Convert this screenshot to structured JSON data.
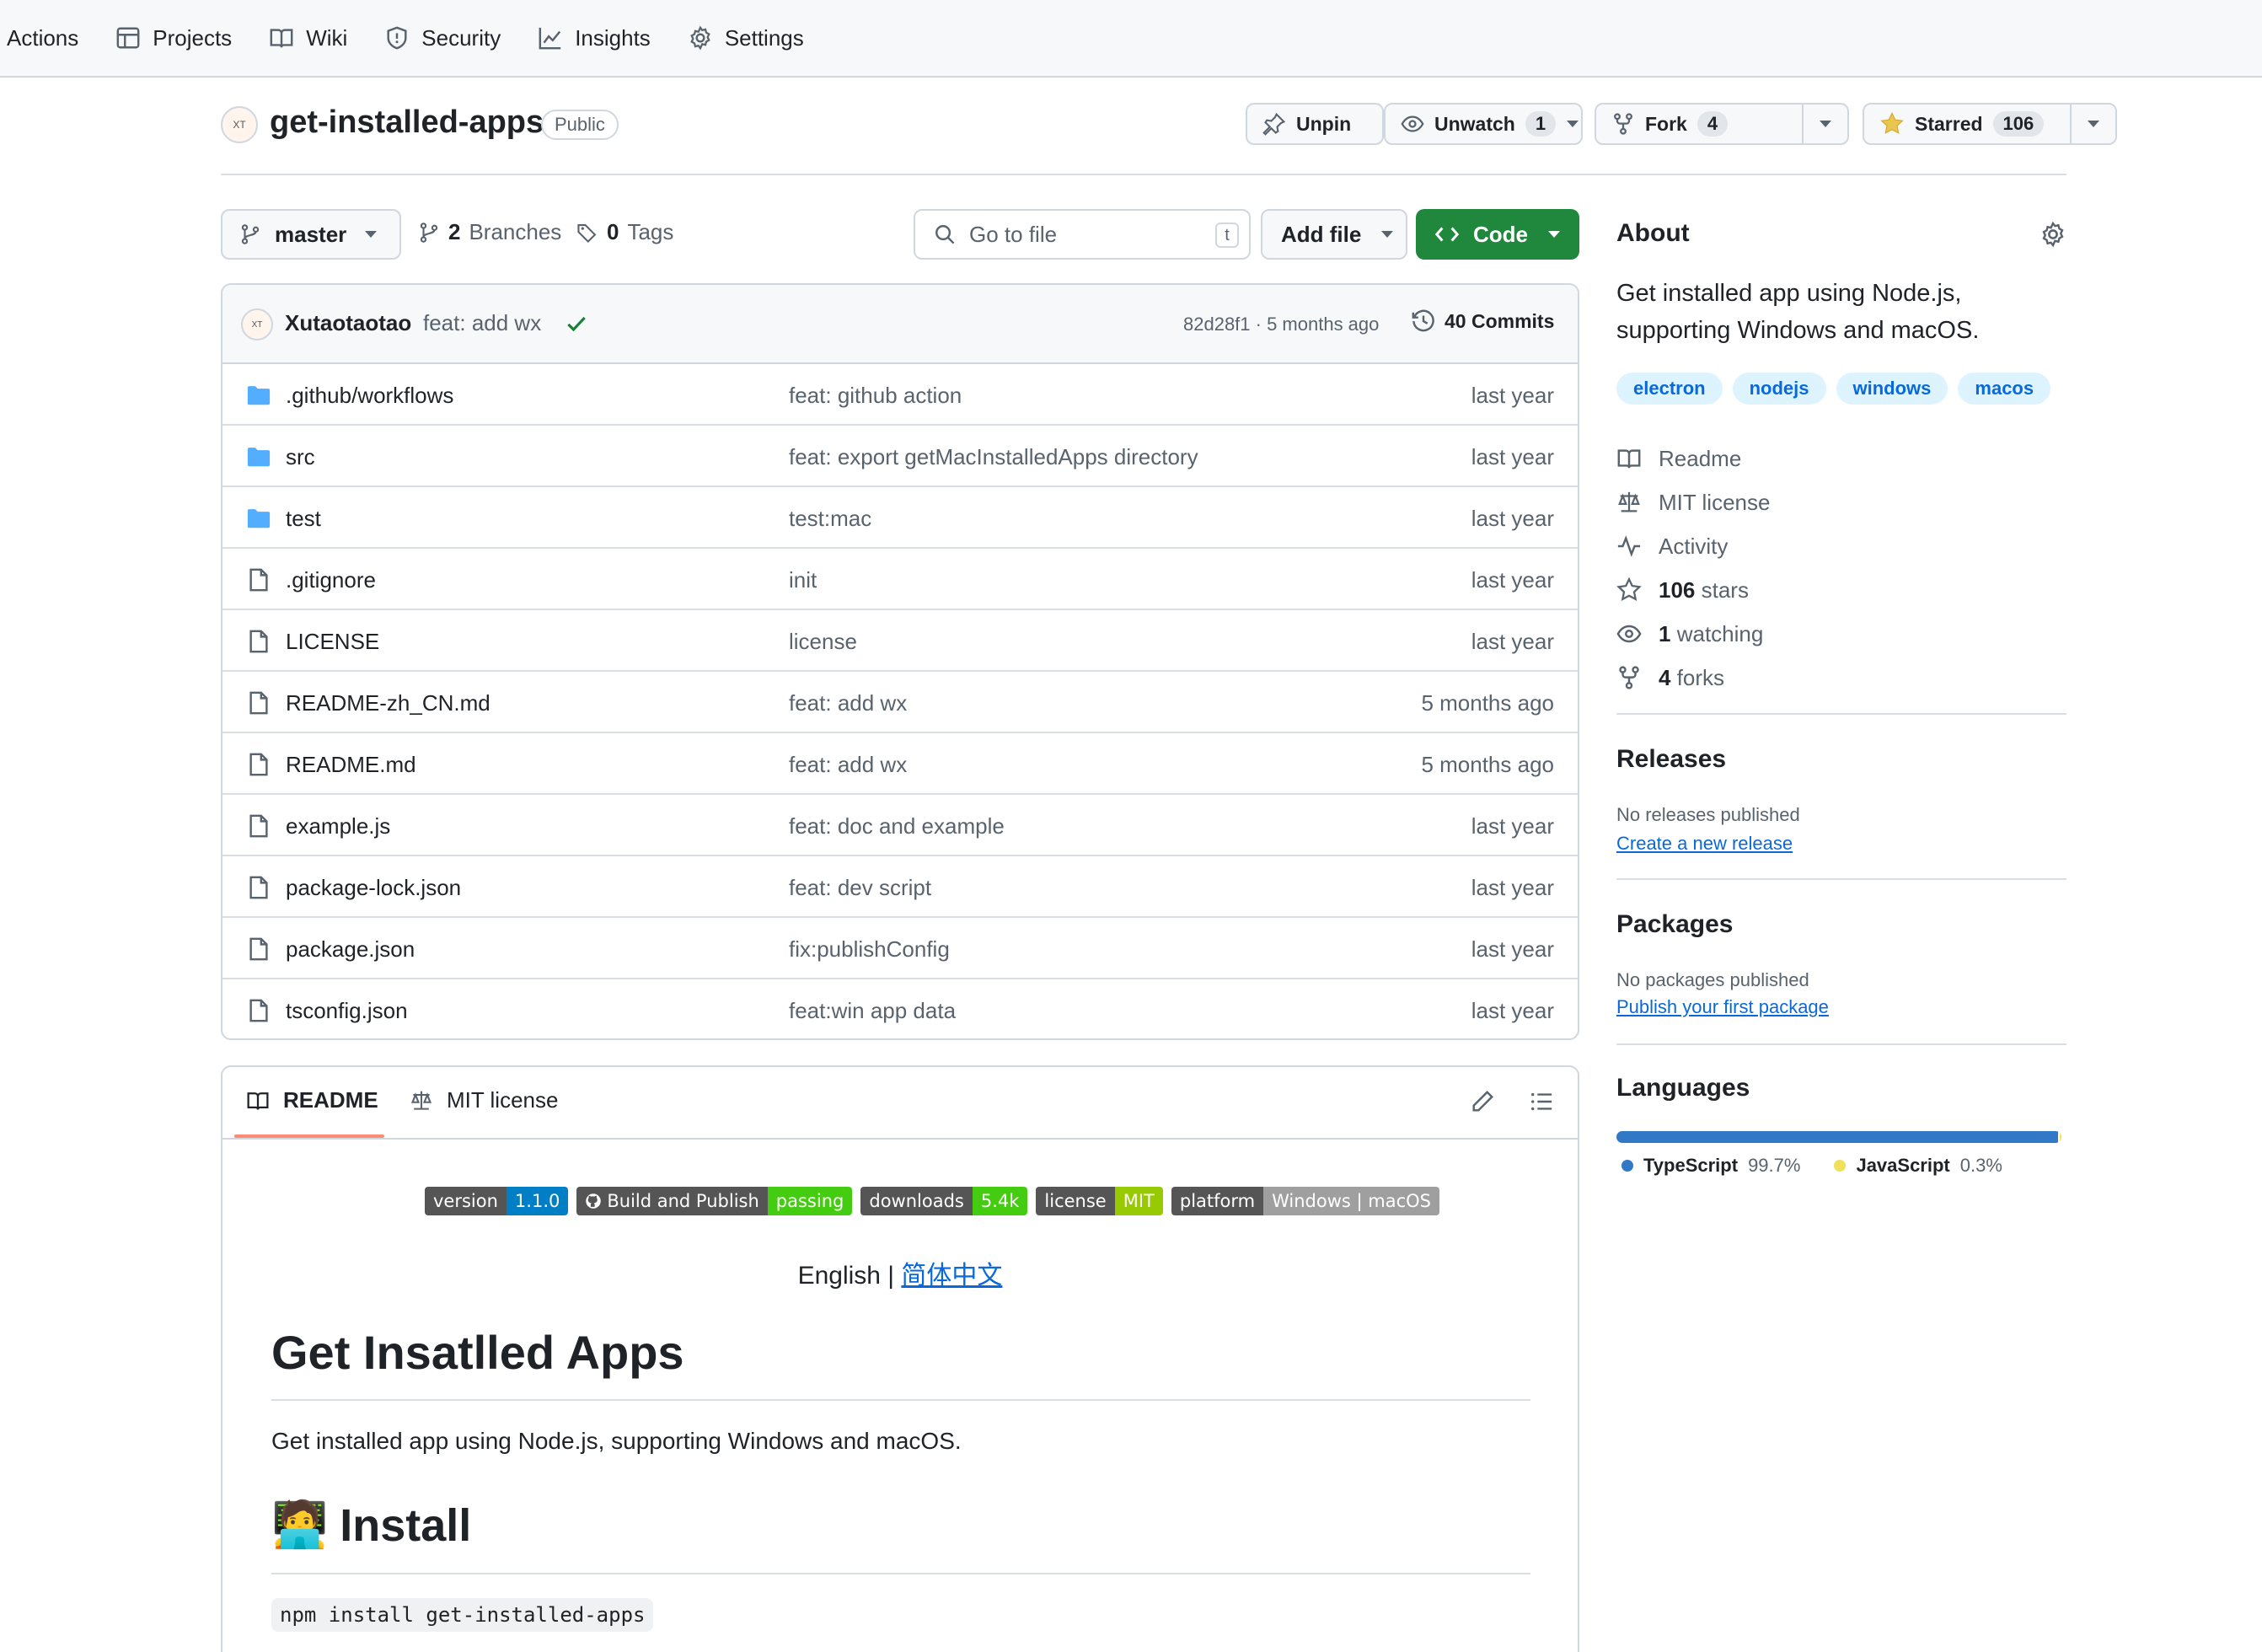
{
  "nav": {
    "items": [
      {
        "label": "Actions"
      },
      {
        "label": "Projects"
      },
      {
        "label": "Wiki"
      },
      {
        "label": "Security"
      },
      {
        "label": "Insights"
      },
      {
        "label": "Settings"
      }
    ]
  },
  "repo": {
    "avatar_text": "XT",
    "name": "get-installed-apps",
    "visibility": "Public",
    "unpin_label": "Unpin",
    "unwatch_label": "Unwatch",
    "watch_count": "1",
    "fork_label": "Fork",
    "fork_count": "4",
    "star_label": "Starred",
    "star_count": "106"
  },
  "toolbar": {
    "branch": "master",
    "branches_count": "2",
    "branches_label": "Branches",
    "tags_count": "0",
    "tags_label": "Tags",
    "goto_placeholder": "Go to file",
    "goto_shortcut": "t",
    "add_file_label": "Add file",
    "code_label": "Code"
  },
  "commit": {
    "author": "Xutaotaotao",
    "message": "feat: add wx",
    "sha_time": "82d28f1 · 5 months ago",
    "commits_label": "40 Commits"
  },
  "files": [
    {
      "type": "folder",
      "name": ".github/workflows",
      "commit": "feat: github action",
      "time": "last year"
    },
    {
      "type": "folder",
      "name": "src",
      "commit": "feat: export getMacInstalledApps directory",
      "time": "last year"
    },
    {
      "type": "folder",
      "name": "test",
      "commit": "test:mac",
      "time": "last year"
    },
    {
      "type": "file",
      "name": ".gitignore",
      "commit": "init",
      "time": "last year"
    },
    {
      "type": "file",
      "name": "LICENSE",
      "commit": "license",
      "time": "last year"
    },
    {
      "type": "file",
      "name": "README-zh_CN.md",
      "commit": "feat: add wx",
      "time": "5 months ago"
    },
    {
      "type": "file",
      "name": "README.md",
      "commit": "feat: add wx",
      "time": "5 months ago"
    },
    {
      "type": "file",
      "name": "example.js",
      "commit": "feat: doc and example",
      "time": "last year"
    },
    {
      "type": "file",
      "name": "package-lock.json",
      "commit": "feat: dev script",
      "time": "last year"
    },
    {
      "type": "file",
      "name": "package.json",
      "commit": "fix:publishConfig",
      "time": "last year"
    },
    {
      "type": "file",
      "name": "tsconfig.json",
      "commit": "feat:win app data",
      "time": "last year"
    }
  ],
  "readme": {
    "tab_readme": "README",
    "tab_license": "MIT license",
    "badges": [
      {
        "left": "version",
        "right": "1.1.0",
        "color": "#007ec6"
      },
      {
        "left": "Build and Publish",
        "right": "passing",
        "color": "#4c1"
      },
      {
        "left": "downloads",
        "right": "5.4k",
        "color": "#4c1"
      },
      {
        "left": "license",
        "right": "MIT",
        "color": "#97ca00"
      },
      {
        "left": "platform",
        "right": "Windows | macOS",
        "color": "#9f9f9f"
      }
    ],
    "lang_prefix": "English | ",
    "lang_link": "简体中文",
    "h1": "Get Insatlled Apps",
    "description": "Get installed app using Node.js, supporting Windows and macOS.",
    "h2_emoji": "🧑‍💻",
    "h2": "Install",
    "install_cmd": "npm install get-installed-apps"
  },
  "about": {
    "title": "About",
    "description": "Get installed app using Node.js, supporting Windows and macOS.",
    "topics": [
      "electron",
      "nodejs",
      "windows",
      "macos"
    ],
    "links": {
      "readme": "Readme",
      "license": "MIT license",
      "activity": "Activity",
      "stars_count": "106",
      "stars_label": "stars",
      "watching_count": "1",
      "watching_label": "watching",
      "forks_count": "4",
      "forks_label": "forks"
    }
  },
  "releases": {
    "title": "Releases",
    "empty": "No releases published",
    "link": "Create a new release"
  },
  "packages": {
    "title": "Packages",
    "empty": "No packages published",
    "link": "Publish your first package"
  },
  "languages": {
    "title": "Languages",
    "items": [
      {
        "name": "TypeScript",
        "percent": "99.7%",
        "value": 99.7,
        "color": "#3178c6"
      },
      {
        "name": "JavaScript",
        "percent": "0.3%",
        "value": 0.3,
        "color": "#f1e05a"
      }
    ]
  },
  "colors": {
    "accent": "#0969da",
    "code_green": "#1f883d",
    "tab_underline": "#fd8c73",
    "folder": "#54aeff"
  }
}
